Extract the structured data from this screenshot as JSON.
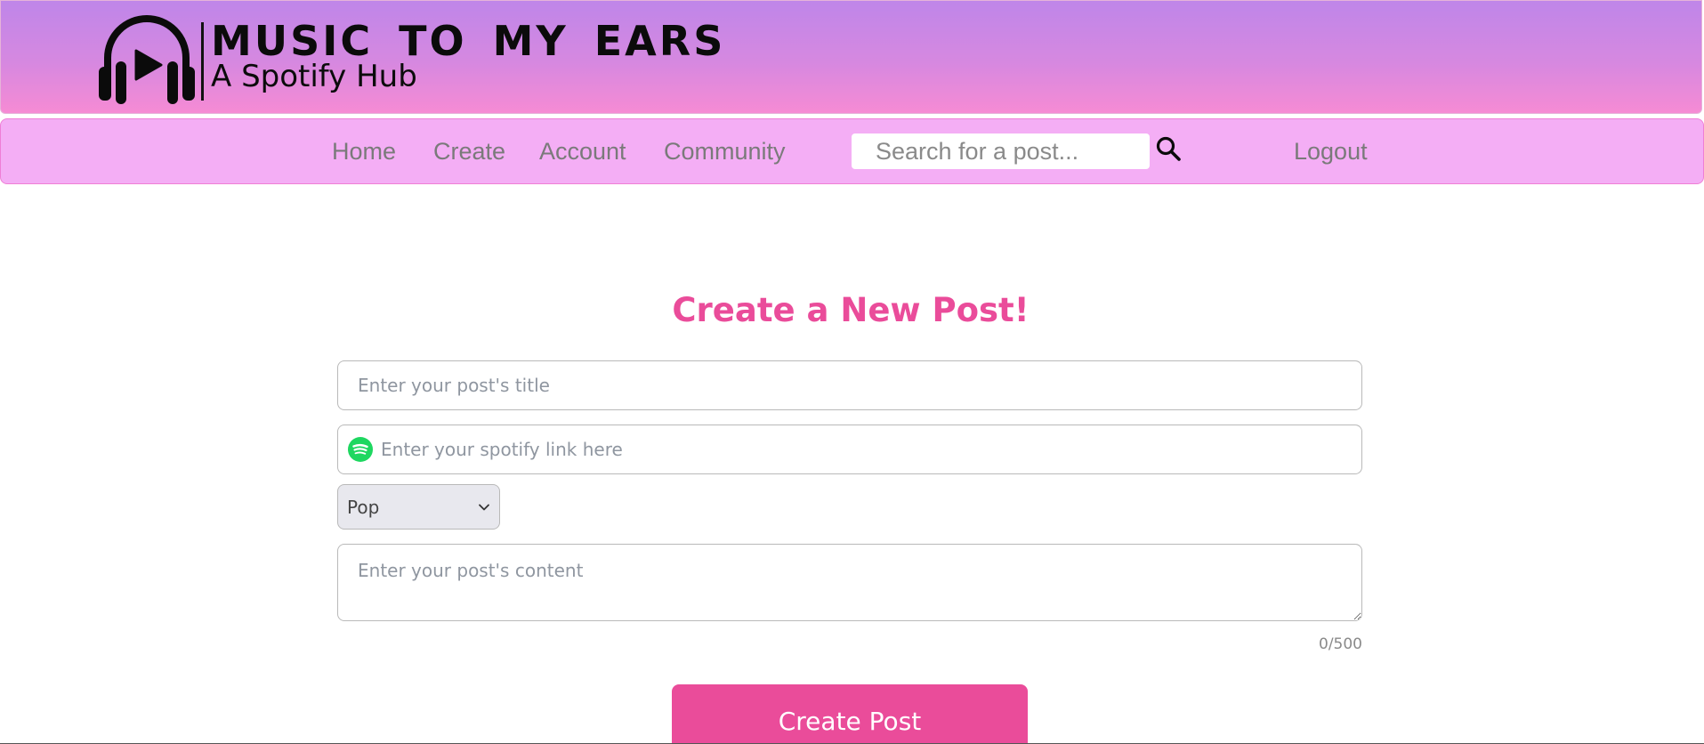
{
  "header": {
    "logo_title": "MUSIC TO MY EARS",
    "logo_subtitle": "A Spotify Hub",
    "logo_icon": "headphones-play-icon"
  },
  "nav": {
    "items": [
      {
        "label": "Home"
      },
      {
        "label": "Create"
      },
      {
        "label": "Account"
      },
      {
        "label": "Community"
      }
    ],
    "search_placeholder": "Search for a post...",
    "search_icon": "magnifier-icon",
    "logout_label": "Logout"
  },
  "form": {
    "heading": "Create a New Post!",
    "title_placeholder": "Enter your post's title",
    "spotify_placeholder": "Enter your spotify link here",
    "spotify_icon": "spotify-icon",
    "genre_selected": "Pop",
    "content_placeholder": "Enter your post's content",
    "char_count": "0/500",
    "submit_label": "Create Post"
  },
  "colors": {
    "banner_top": "#bf86e9",
    "banner_bottom": "#f68bd4",
    "nav_bg": "#f4aef5",
    "accent": "#ea4c9a",
    "spotify_green": "#1ed760"
  }
}
